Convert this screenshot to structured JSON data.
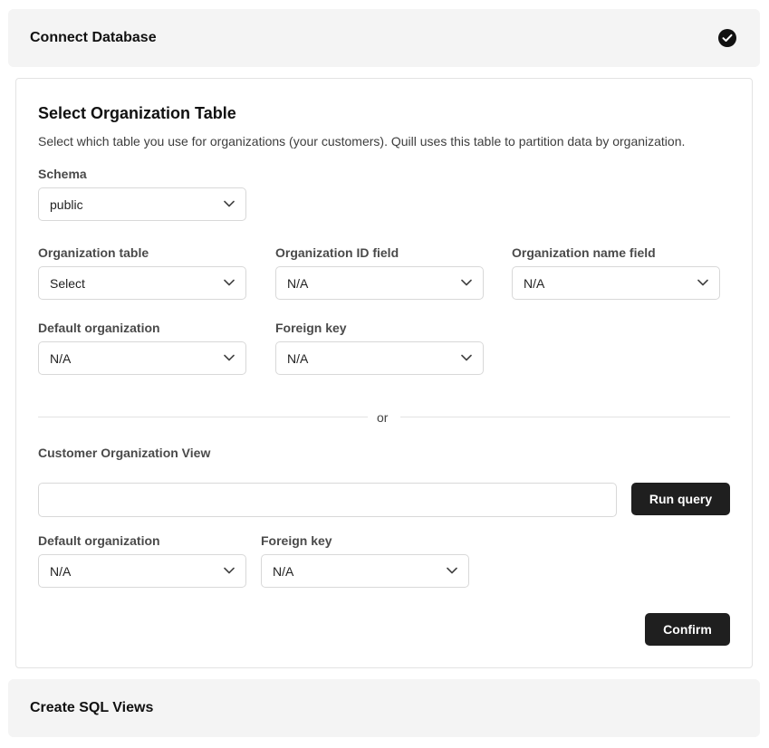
{
  "steps": {
    "connect_database": {
      "title": "Connect Database",
      "icon": "check-circle-icon"
    },
    "create_sql_views": {
      "title": "Create SQL Views"
    }
  },
  "card": {
    "title": "Select Organization Table",
    "description": "Select which table you use for organizations (your customers). Quill uses this table to partition data by organization."
  },
  "schema": {
    "label": "Schema",
    "value": "public"
  },
  "org_table": {
    "label": "Organization table",
    "value": "Select"
  },
  "org_id_field": {
    "label": "Organization ID field",
    "value": "N/A"
  },
  "org_name_field": {
    "label": "Organization name field",
    "value": "N/A"
  },
  "default_org": {
    "label": "Default organization",
    "value": "N/A"
  },
  "foreign_key": {
    "label": "Foreign key",
    "value": "N/A"
  },
  "divider": {
    "text": "or"
  },
  "custom_view": {
    "label": "Customer Organization View",
    "query_value": "",
    "run_label": "Run query",
    "default_org": {
      "label": "Default organization",
      "value": "N/A"
    },
    "foreign_key": {
      "label": "Foreign key",
      "value": "N/A"
    }
  },
  "confirm_label": "Confirm",
  "colors": {
    "button_bg": "#1f1f1f",
    "header_bg": "#f4f4f4",
    "border": "#d8d8d8"
  }
}
